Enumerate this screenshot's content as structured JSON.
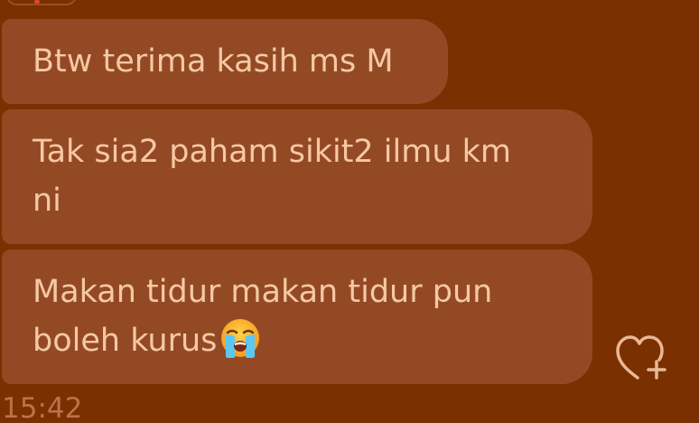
{
  "messages": [
    {
      "lines": [
        "Btw terima kasih ms M"
      ]
    },
    {
      "lines": [
        "Tak sia2 paham sikit2 ilmu km",
        "ni"
      ]
    },
    {
      "lines": [
        "Makan tidur makan tidur pun",
        "boleh kurus"
      ],
      "emoji": "loudly-crying-face"
    }
  ],
  "reaction_button": {
    "icon": "heart-plus-icon"
  },
  "timestamp": "15:42",
  "colors": {
    "background": "#7a3000",
    "bubble": "#934a24",
    "text": "#f6c8a5",
    "timestamp": "#b9734a"
  }
}
